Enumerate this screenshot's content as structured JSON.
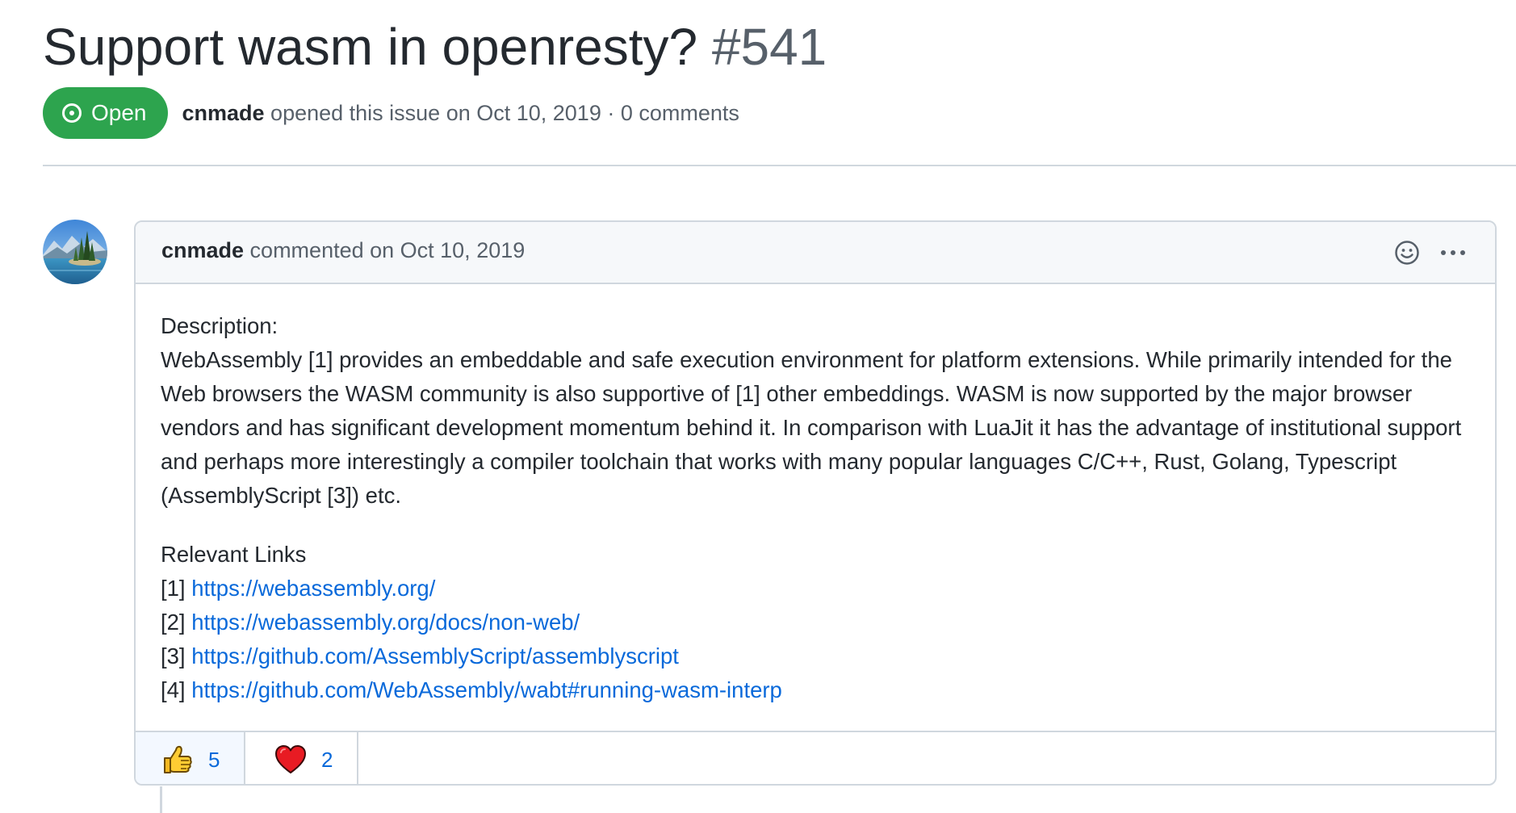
{
  "issue": {
    "title": "Support wasm in openresty?",
    "number": "#541",
    "state": "Open",
    "author": "cnmade",
    "meta": " opened this issue on Oct 10, 2019 · 0 comments"
  },
  "comment": {
    "author": "cnmade",
    "meta": " commented on Oct 10, 2019",
    "description_label": "Description:",
    "description": "WebAssembly [1] provides an embeddable and safe execution environment for platform extensions. While primarily intended for the Web browsers the WASM community is also supportive of [1] other embeddings. WASM is now supported by the major browser vendors and has significant development momentum behind it. In comparison with LuaJit it has the advantage of institutional support and perhaps more interestingly a compiler toolchain that works with many popular languages C/C++, Rust, Golang, Typescript (AssemblyScript [3]) etc.",
    "links_label": "Relevant Links",
    "links": [
      {
        "index": "[1] ",
        "url": "https://webassembly.org/"
      },
      {
        "index": "[2] ",
        "url": "https://webassembly.org/docs/non-web/"
      },
      {
        "index": "[3] ",
        "url": "https://github.com/AssemblyScript/assemblyscript"
      },
      {
        "index": "[4] ",
        "url": "https://github.com/WebAssembly/wabt#running-wasm-interp"
      }
    ]
  },
  "reactions": [
    {
      "icon": "thumbs-up-icon",
      "count": "5"
    },
    {
      "icon": "heart-icon",
      "count": "2"
    }
  ],
  "colors": {
    "open_green": "#2da44e",
    "link_blue": "#0969da",
    "border": "#d0d7de",
    "muted_text": "#57606a"
  }
}
